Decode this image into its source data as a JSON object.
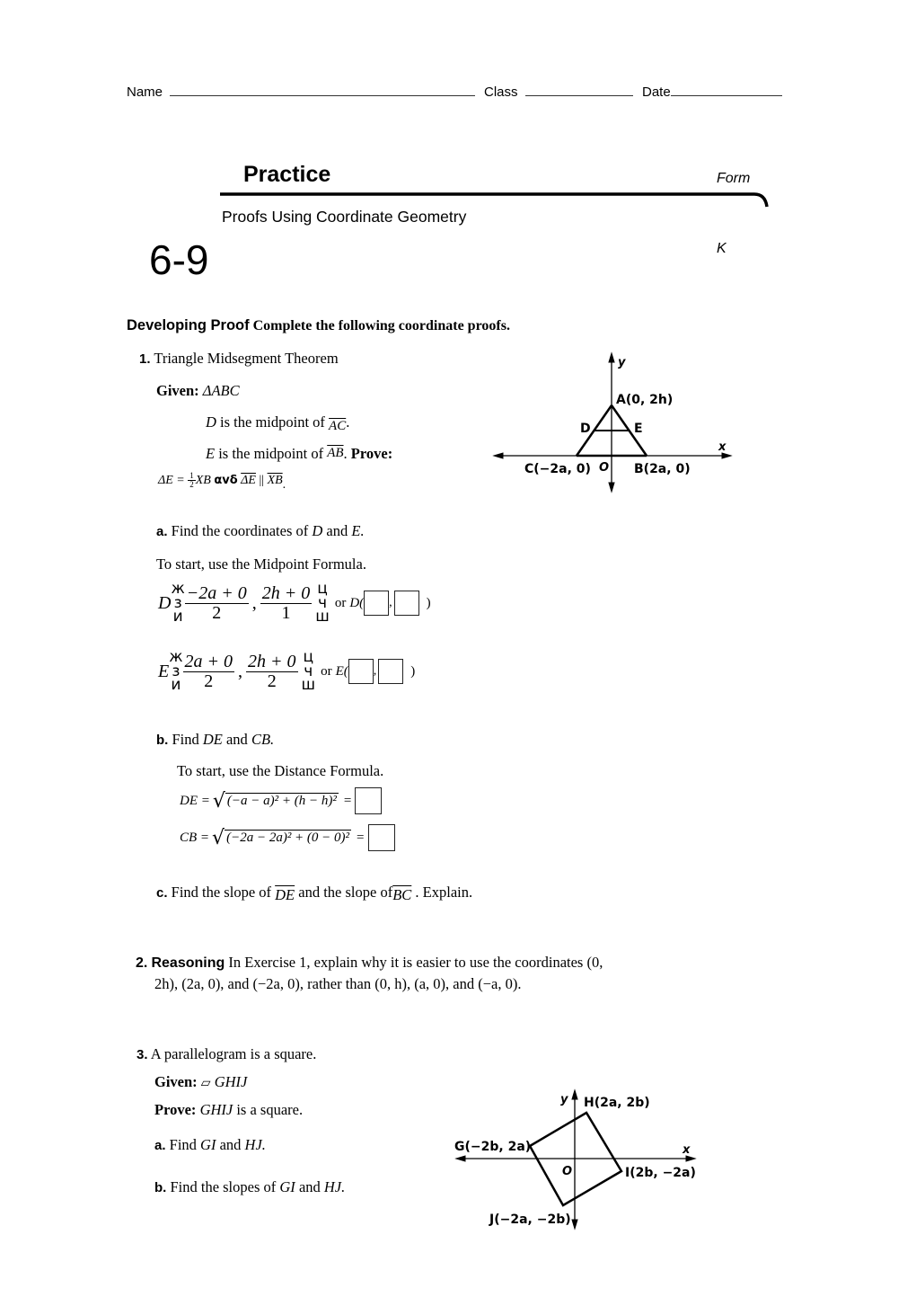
{
  "header": {
    "name_label": "Name",
    "class_label": "Class",
    "date_label": "Date"
  },
  "title": {
    "practice": "Practice",
    "form": "Form",
    "form_letter": "K",
    "lesson_number": "6-9",
    "subtitle": "Proofs Using Coordinate Geometry"
  },
  "instructions": {
    "lead": "Developing Proof",
    "text": "Complete the following coordinate proofs."
  },
  "problem1": {
    "number": "1.",
    "title": "Triangle Midsegment Theorem",
    "given_label": "Given:",
    "given_value": "ΔABC",
    "given_d_pre": "D",
    "given_d_text": "is the midpoint of",
    "given_d_seg": "AC",
    "given_e_pre": "E",
    "given_e_text": "is the midpoint of",
    "given_e_seg": "AB",
    "prove_label": "Prove:",
    "prove_lhs": "ΔE =",
    "prove_half_num": "1",
    "prove_half_den": "2",
    "prove_xb": "XB",
    "prove_and": "αvδ",
    "prove_seg1": "ΔE",
    "prove_parallel": "||",
    "prove_seg2": "XB",
    "diagram": {
      "y_label": "y",
      "x_label": "x",
      "origin": "O",
      "point_a": "A(0, 2h)",
      "point_b": "B(2a, 0)",
      "point_c": "C(−2a, 0)",
      "point_d": "D",
      "point_e": "E"
    },
    "part_a": {
      "label": "a.",
      "text_pre": "Find the coordinates of",
      "var1": "D",
      "and": "and",
      "var2": "E.",
      "hint": "To start, use the Midpoint Formula.",
      "d_var": "D",
      "d_num1": "−2a + 0",
      "d_den1": "2",
      "d_num2": "2h + 0",
      "d_den2": "1",
      "e_var": "E",
      "e_num1": "2a + 0",
      "e_den1": "2",
      "e_num2": "2h + 0",
      "e_den2": "2",
      "or": "or",
      "d_point": "D(",
      "e_point": "E(",
      "close": ")",
      "bracket_left": "ж\nз\nи",
      "bracket_right": "ц\nч\nш"
    },
    "part_b": {
      "label": "b.",
      "text_pre": "Find",
      "var1": "DE",
      "and": "and",
      "var2": "CB.",
      "hint": "To start, use the Distance Formula.",
      "de_lhs": "DE =",
      "de_radicand": "(−a − a)² + (h − h)²",
      "cb_lhs": "CB =",
      "cb_radicand": "(−2a − 2a)² + (0 − 0)²",
      "equals": "="
    },
    "part_c": {
      "label": "c.",
      "text1": "Find the slope of",
      "seg1": "DE",
      "text2": "and the slope of",
      "seg2": "BC",
      "text3": ". Explain."
    }
  },
  "problem2": {
    "number": "2.",
    "lead": "Reasoning",
    "line1": "In Exercise 1, explain why it is easier to use the coordinates (0,",
    "line2": "2h), (2a, 0), and (−2a, 0), rather than (0, h), (a, 0), and (−a, 0)."
  },
  "problem3": {
    "number": "3.",
    "title": "A parallelogram is a square.",
    "given_label": "Given:",
    "given_symbol": "▱",
    "given_value": "GHIJ",
    "prove_label": "Prove:",
    "prove_var": "GHIJ",
    "prove_text": "is a square.",
    "part_a": {
      "label": "a.",
      "text": "Find",
      "var1": "GI",
      "and": "and",
      "var2": "HJ."
    },
    "part_b": {
      "label": "b.",
      "text": "Find the slopes of",
      "var1": "GI",
      "and": "and",
      "var2": "HJ."
    },
    "diagram": {
      "y_label": "y",
      "x_label": "x",
      "origin": "O",
      "point_g": "G(−2b, 2a)",
      "point_h": "H(2a, 2b)",
      "point_i": "I(2b, −2a)",
      "point_j": "J(−2a, −2b)"
    }
  }
}
